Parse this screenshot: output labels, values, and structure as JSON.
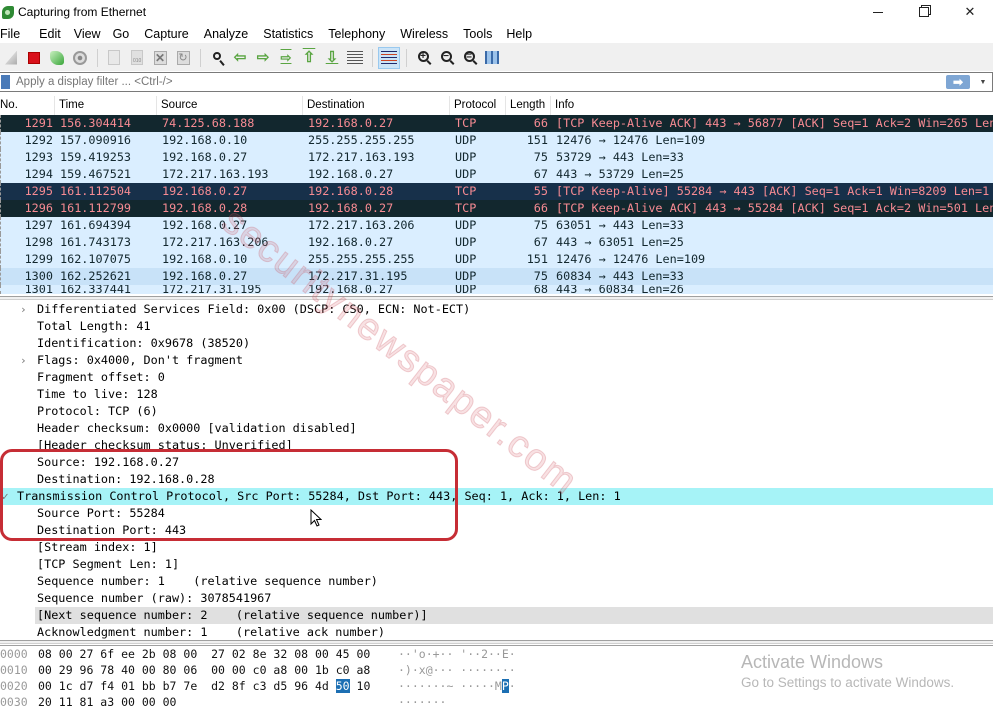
{
  "window": {
    "title": "Capturing from Ethernet",
    "controls": {
      "minimize": "minimize",
      "maximize": "restore",
      "close": "close"
    }
  },
  "menu": [
    "File",
    "Edit",
    "View",
    "Go",
    "Capture",
    "Analyze",
    "Statistics",
    "Telephony",
    "Wireless",
    "Tools",
    "Help"
  ],
  "toolbar": {
    "icons": [
      "start-capture-icon",
      "stop-capture-icon",
      "restart-capture-icon",
      "capture-options-icon",
      "open-file-icon",
      "save-file-icon",
      "close-file-icon",
      "reload-file-icon",
      "find-packet-icon",
      "go-back-icon",
      "go-forward-icon",
      "go-to-packet-icon",
      "first-packet-icon",
      "last-packet-icon",
      "autoscroll-icon",
      "colorize-icon",
      "zoom-in-icon",
      "zoom-out-icon",
      "normal-size-icon",
      "resize-columns-icon"
    ],
    "active": "colorize-icon"
  },
  "filter": {
    "placeholder": "Apply a display filter ... <Ctrl-/>",
    "value": "",
    "apply_icon": "arrow-right-icon"
  },
  "packet_list": {
    "columns": [
      "No.",
      "Time",
      "Source",
      "Destination",
      "Protocol",
      "Length",
      "Info"
    ],
    "rows": [
      {
        "no": "1291",
        "time": "156.304414",
        "src": "74.125.68.188",
        "dst": "192.168.0.27",
        "proto": "TCP",
        "len": "66",
        "info": "[TCP Keep-Alive ACK] 443 → 56877 [ACK] Seq=1 Ack=2 Win=265 Len…",
        "style": "dark"
      },
      {
        "no": "1292",
        "time": "157.090916",
        "src": "192.168.0.10",
        "dst": "255.255.255.255",
        "proto": "UDP",
        "len": "151",
        "info": "12476 → 12476 Len=109",
        "style": "udp"
      },
      {
        "no": "1293",
        "time": "159.419253",
        "src": "192.168.0.27",
        "dst": "172.217.163.193",
        "proto": "UDP",
        "len": "75",
        "info": "53729 → 443 Len=33",
        "style": "udp"
      },
      {
        "no": "1294",
        "time": "159.467521",
        "src": "172.217.163.193",
        "dst": "192.168.0.27",
        "proto": "UDP",
        "len": "67",
        "info": "443 → 53729 Len=25",
        "style": "udp"
      },
      {
        "no": "1295",
        "time": "161.112504",
        "src": "192.168.0.27",
        "dst": "192.168.0.28",
        "proto": "TCP",
        "len": "55",
        "info": "[TCP Keep-Alive] 55284 → 443 [ACK] Seq=1 Ack=1 Win=8209 Len=1",
        "style": "dark sel"
      },
      {
        "no": "1296",
        "time": "161.112799",
        "src": "192.168.0.28",
        "dst": "192.168.0.27",
        "proto": "TCP",
        "len": "66",
        "info": "[TCP Keep-Alive ACK] 443 → 55284 [ACK] Seq=1 Ack=2 Win=501 Len…",
        "style": "dark"
      },
      {
        "no": "1297",
        "time": "161.694394",
        "src": "192.168.0.27",
        "dst": "172.217.163.206",
        "proto": "UDP",
        "len": "75",
        "info": "63051 → 443 Len=33",
        "style": "udp"
      },
      {
        "no": "1298",
        "time": "161.743173",
        "src": "172.217.163.206",
        "dst": "192.168.0.27",
        "proto": "UDP",
        "len": "67",
        "info": "443 → 63051 Len=25",
        "style": "udp"
      },
      {
        "no": "1299",
        "time": "162.107075",
        "src": "192.168.0.10",
        "dst": "255.255.255.255",
        "proto": "UDP",
        "len": "151",
        "info": "12476 → 12476 Len=109",
        "style": "udp"
      },
      {
        "no": "1300",
        "time": "162.252621",
        "src": "192.168.0.27",
        "dst": "172.217.31.195",
        "proto": "UDP",
        "len": "75",
        "info": "60834 → 443 Len=33",
        "style": "udp alt"
      },
      {
        "no": "1301",
        "time": "162.337441",
        "src": "172.217.31.195",
        "dst": "192.168.0.27",
        "proto": "UDP",
        "len": "68",
        "info": "443 → 60834 Len=26",
        "style": "udp cut"
      }
    ]
  },
  "details": {
    "rows": [
      {
        "text": "Differentiated Services Field: 0x00 (DSCP: CS0, ECN: Not-ECT)",
        "expander": "›",
        "level": 1
      },
      {
        "text": "Total Length: 41",
        "expander": "",
        "level": 1
      },
      {
        "text": "Identification: 0x9678 (38520)",
        "expander": "",
        "level": 1
      },
      {
        "text": "Flags: 0x4000, Don't fragment",
        "expander": "›",
        "level": 1
      },
      {
        "text": "Fragment offset: 0",
        "expander": "",
        "level": 1
      },
      {
        "text": "Time to live: 128",
        "expander": "",
        "level": 1
      },
      {
        "text": "Protocol: TCP (6)",
        "expander": "",
        "level": 1
      },
      {
        "text": "Header checksum: 0x0000 [validation disabled]",
        "expander": "",
        "level": 1
      },
      {
        "text": "[Header checksum status: Unverified]",
        "expander": "",
        "level": 1
      },
      {
        "text": "Source: 192.168.0.27",
        "expander": "",
        "level": 1
      },
      {
        "text": "Destination: 192.168.0.28",
        "expander": "",
        "level": 1
      },
      {
        "text": "Transmission Control Protocol, Src Port: 55284, Dst Port: 443, Seq: 1, Ack: 1, Len: 1",
        "expander": "✓",
        "level": 0,
        "selected": true
      },
      {
        "text": "Source Port: 55284",
        "expander": "",
        "level": 1
      },
      {
        "text": "Destination Port: 443",
        "expander": "",
        "level": 1
      },
      {
        "text": "[Stream index: 1]",
        "expander": "",
        "level": 1
      },
      {
        "text": "[TCP Segment Len: 1]",
        "expander": "",
        "level": 1
      },
      {
        "text": "Sequence number: 1    (relative sequence number)",
        "expander": "",
        "level": 1
      },
      {
        "text": "Sequence number (raw): 3078541967",
        "expander": "",
        "level": 1
      },
      {
        "text": "[Next sequence number: 2    (relative sequence number)]",
        "expander": "",
        "level": 1,
        "hover": true
      },
      {
        "text": "Acknowledgment number: 1    (relative ack number)",
        "expander": "",
        "level": 1
      }
    ]
  },
  "bytes": {
    "rows": [
      {
        "offset": "0000",
        "hex_a": "08 00 27 6f ee 2b 08 00",
        "hex_b": "27 02 8e 32 08 00 45 00",
        "ascii": "··'o·+·· '··2··E·"
      },
      {
        "offset": "0010",
        "hex_a": "00 29 96 78 40 00 80 06",
        "hex_b": "00 00 c0 a8 00 1b c0 a8",
        "ascii": "·)·x@··· ········"
      },
      {
        "offset": "0020",
        "hex_a": "00 1c d7 f4 01 bb b7 7e",
        "hex_b": "d2 8f c3 d5 96 4d",
        "hex_hl": "50",
        "hex_c": "10",
        "ascii": "·······~ ·····M",
        "ascii_hl": "P",
        "ascii_c": "·"
      },
      {
        "offset": "0030",
        "hex_a": "20 11 81 a3 00 00 00",
        "hex_b": "",
        "ascii": "·······"
      }
    ]
  },
  "overlay": {
    "activate_title": "Activate Windows",
    "activate_sub": "Go to Settings to activate Windows.",
    "watermark": "securitynewspaper.com"
  },
  "colors": {
    "tcp_row_bg": "#12272e",
    "tcp_row_fg": "#f78b93",
    "udp_row_bg": "#daeeff",
    "selected_detail_bg": "#a6f3f7",
    "annotation_border": "#c62d35",
    "byte_highlight": "#1c6fb3"
  }
}
